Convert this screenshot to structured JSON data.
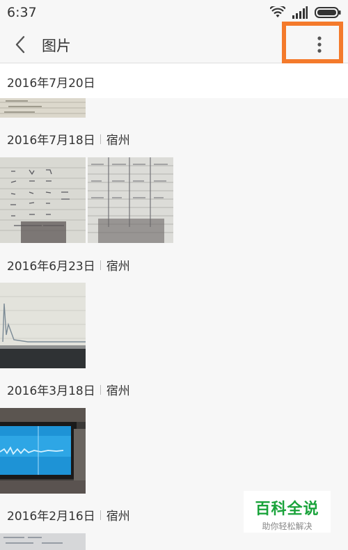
{
  "status_bar": {
    "time": "6:37"
  },
  "app_bar": {
    "title": "图片"
  },
  "groups": [
    {
      "date": "2016年7月20日",
      "location": ""
    },
    {
      "date": "2016年7月18日",
      "location": "宿州"
    },
    {
      "date": "2016年6月23日",
      "location": "宿州"
    },
    {
      "date": "2016年3月18日",
      "location": "宿州"
    },
    {
      "date": "2016年2月16日",
      "location": "宿州"
    }
  ],
  "watermark": {
    "title": "百科全说",
    "subtitle": "助你轻松解决"
  }
}
